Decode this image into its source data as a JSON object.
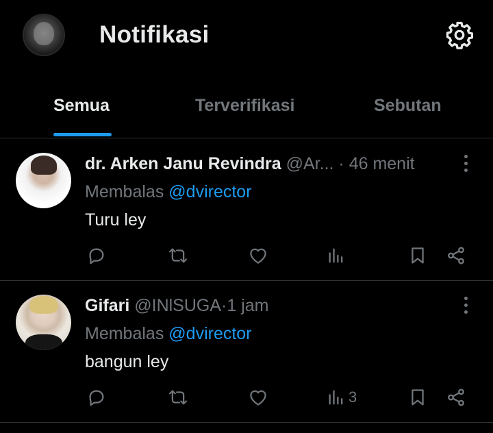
{
  "header": {
    "title": "Notifikasi",
    "settings_icon": "gear-icon"
  },
  "tabs": [
    {
      "label": "Semua",
      "active": true
    },
    {
      "label": "Terverifikasi",
      "active": false
    },
    {
      "label": "Sebutan",
      "active": false
    }
  ],
  "notifications": [
    {
      "author": "dr. Arken Janu Revindra",
      "handle": "@Ar...",
      "time": "46 menit",
      "reply_prefix": "Membalas",
      "reply_to": "@dvirector",
      "text": "Turu ley",
      "views": ""
    },
    {
      "author": "Gifari",
      "handle": "@INlSUGA",
      "time": "1 jam",
      "reply_prefix": "Membalas",
      "reply_to": "@dvirector",
      "text": "bangun ley",
      "views": "3"
    }
  ],
  "separator": "·",
  "colors": {
    "background": "#000000",
    "accent": "#1d9bf0",
    "text": "#e7e9ea",
    "muted": "#71767b",
    "divider": "#2f3336"
  }
}
